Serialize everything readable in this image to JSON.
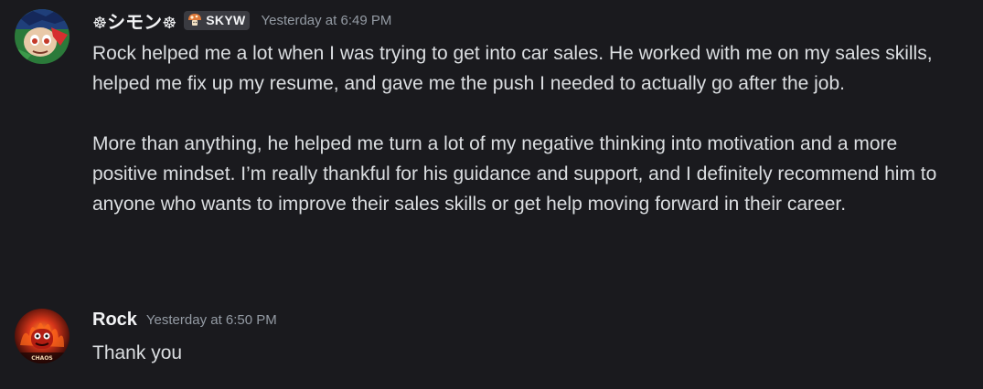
{
  "messages": [
    {
      "username_prefix": "☸",
      "username": "シモン",
      "username_suffix": "☸",
      "tag": {
        "icon": "mushroom-icon",
        "label": "SKYW"
      },
      "timestamp": "Yesterday at 6:49 PM",
      "paragraphs": [
        "Rock helped me a lot when I was trying to get into car sales. He worked with me on my sales skills, helped me fix up my resume, and gave me the push I needed to actually go after the job.",
        "More than anything, he helped me turn a lot of my negative thinking into motivation and a more positive mindset. I’m really thankful for his guidance and support, and I definitely recommend him to anyone who wants to improve their sales skills or get help moving forward in their career."
      ]
    },
    {
      "username": "Rock",
      "timestamp": "Yesterday at 6:50 PM",
      "paragraphs": [
        "Thank you"
      ],
      "avatar_text": "CHAOS"
    }
  ],
  "colors": {
    "background": "#1a1a1e",
    "username": "#f2f3f5",
    "text": "#dbdee1",
    "timestamp": "#949ba4",
    "tag_bg": "#3a3b41"
  }
}
